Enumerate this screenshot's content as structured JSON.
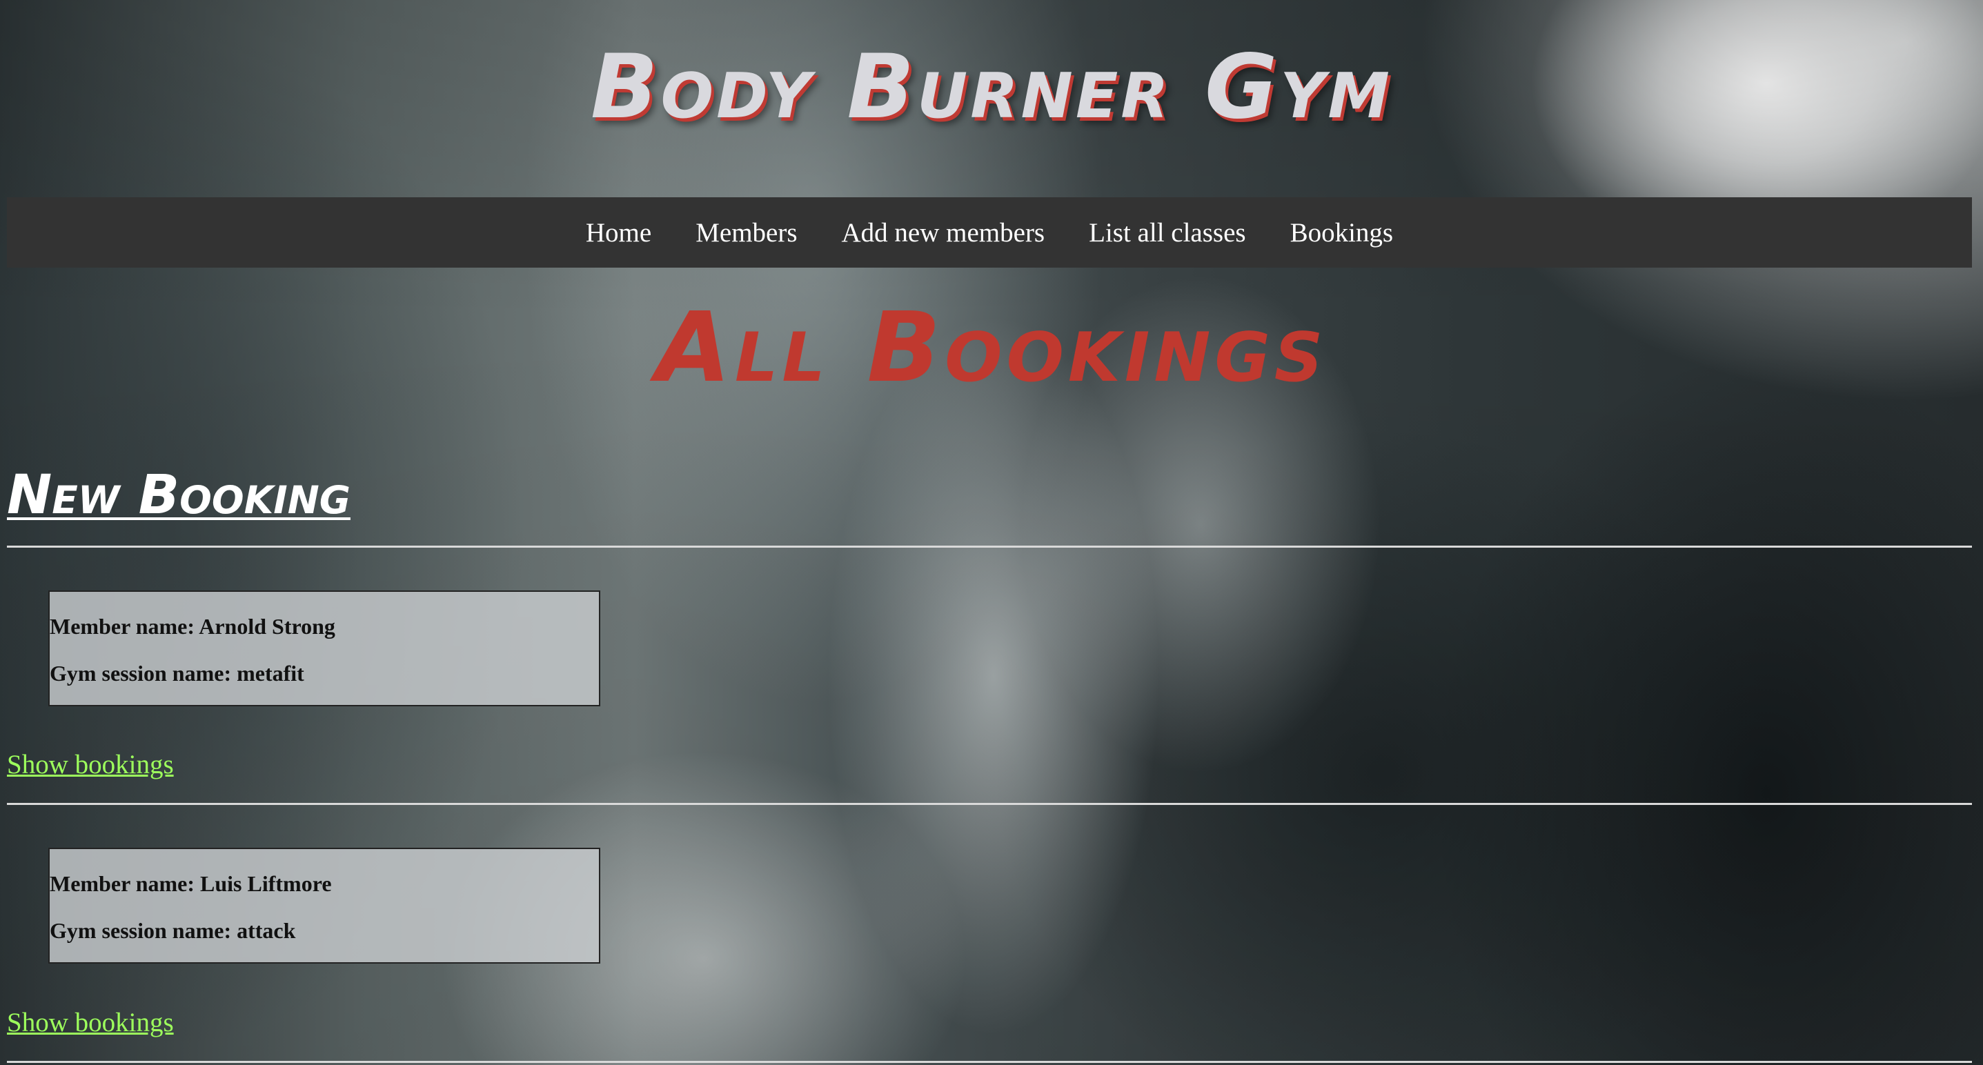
{
  "header": {
    "title": "Body Burner Gym"
  },
  "nav": {
    "items": [
      {
        "label": "Home"
      },
      {
        "label": "Members"
      },
      {
        "label": "Add new members"
      },
      {
        "label": "List all classes"
      },
      {
        "label": "Bookings"
      }
    ]
  },
  "main": {
    "heading": "All Bookings",
    "new_booking_label": "New Booking",
    "bookings": [
      {
        "member": "Member name: Arnold Strong",
        "session": "Gym session name: metafit",
        "link_label": "Show bookings"
      },
      {
        "member": "Member name: Luis Liftmore",
        "session": "Gym session name: attack",
        "link_label": "Show bookings"
      }
    ]
  },
  "colors": {
    "title_text": "#d9d9de",
    "title_shadow": "#c03a33",
    "heading": "#c0392f",
    "navbar_bg": "#333333",
    "link": "#9dff5c"
  }
}
